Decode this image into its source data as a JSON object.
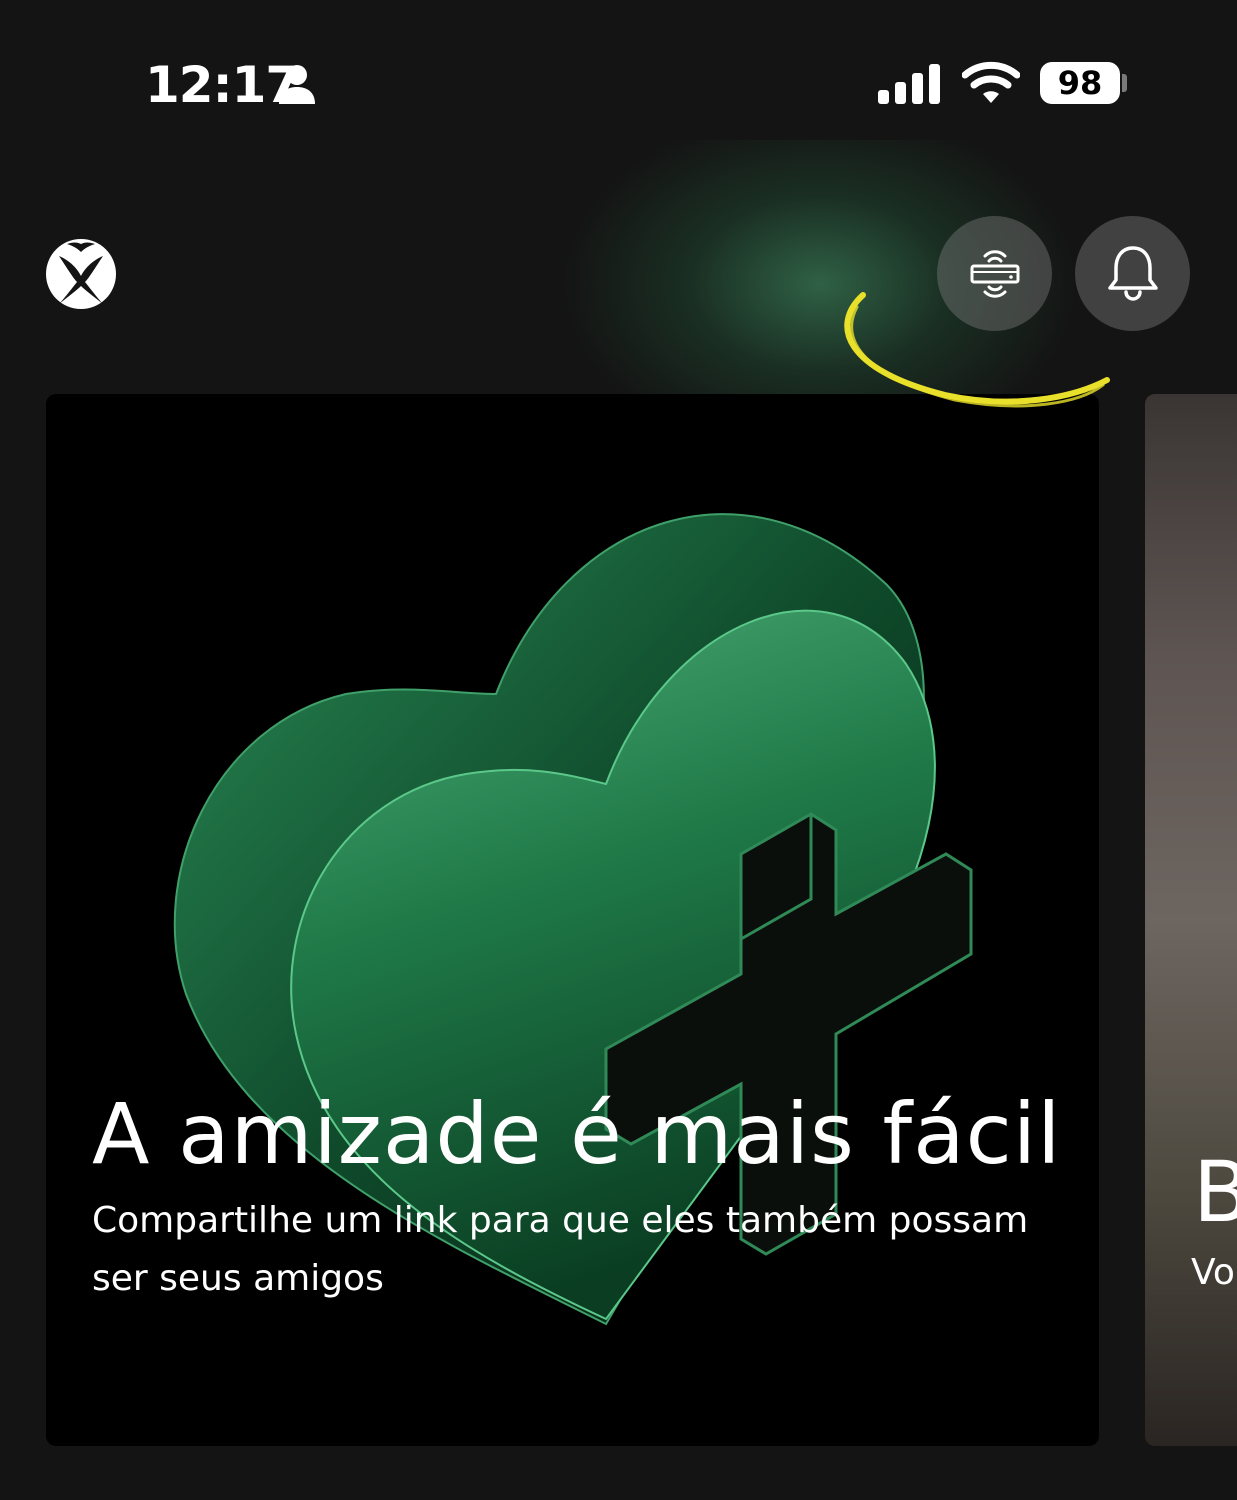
{
  "status_bar": {
    "time": "12:17",
    "battery": "98"
  },
  "header": {
    "logo": "xbox-logo-icon",
    "buttons": [
      "remote-play-icon",
      "bell-icon"
    ]
  },
  "cards": [
    {
      "title": "A amizade é mais fácil",
      "subtitle": "Compartilhe um link para que eles também possam ser seus amigos"
    },
    {
      "title_partial": "B",
      "subtitle_partial": "Vo"
    }
  ],
  "colors": {
    "background": "#141414",
    "accent_green": "#2e8b57",
    "annotation": "#e8e02a"
  }
}
